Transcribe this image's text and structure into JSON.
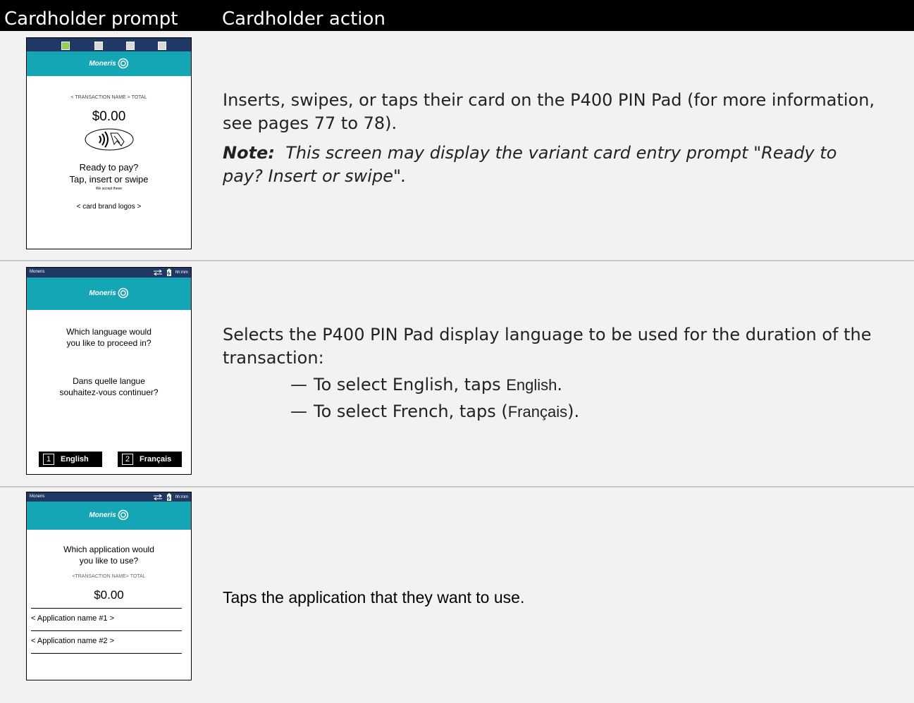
{
  "header": {
    "col_prompt": "Cardholder prompt",
    "col_action": "Cardholder action"
  },
  "rows": [
    {
      "device": {
        "amount_label": "< TRANSACTION NAME > TOTAL",
        "amount": "$0.00",
        "line1": "Ready to pay?",
        "line2": "Tap, insert or swipe",
        "accept": "We accept these",
        "logos": "< card brand logos >"
      },
      "action": {
        "text": "Inserts, swipes, or taps their card on the P400 PIN Pad (for more information, see pages 77 to 78).",
        "note_label": "Note:",
        "note_text": "This screen may display the variant card entry prompt \"Ready to pay? Insert or swipe\"."
      }
    },
    {
      "device": {
        "status_left": "Moneris",
        "status_time": "hh:mm",
        "q1a": "Which language would",
        "q1b": "you like to proceed in?",
        "q2a": "Dans quelle langue",
        "q2b": "souhaitez-vous continuer?",
        "btn1_num": "1",
        "btn1_label": "English",
        "btn2_num": "2",
        "btn2_label": "Français"
      },
      "action": {
        "text": "Selects the P400 PIN Pad display language to be used for the duration of the transaction:",
        "bullet1_prefix": "To select English, taps ",
        "bullet1_kw": "English",
        "bullet1_suffix": ".",
        "bullet2_prefix": "To select French, taps (",
        "bullet2_kw": "Français",
        "bullet2_suffix": ").",
        "dash": "—"
      }
    },
    {
      "device": {
        "status_left": "Moneris",
        "status_time": "hh:mm",
        "q1a": "Which application would",
        "q1b": "you like to use?",
        "amount_label": "<TRANSACTION NAME> TOTAL",
        "amount": "$0.00",
        "app1": "< Application name #1 >",
        "app2": "< Application name #2 >"
      },
      "action": {
        "text": "Taps the application that they want to use."
      }
    }
  ],
  "logo_text": "Moneris",
  "colors": {
    "teal": "#14a6b4",
    "status_bar": "#1f3864",
    "indicator_active": "#92d050",
    "indicator_idle": "#d9d9d9"
  },
  "indicators": [
    "active",
    "idle",
    "idle",
    "idle"
  ],
  "icons": [
    "contactless-icon",
    "moneris-logo-icon",
    "connection-arrows-icon",
    "battery-icon"
  ]
}
